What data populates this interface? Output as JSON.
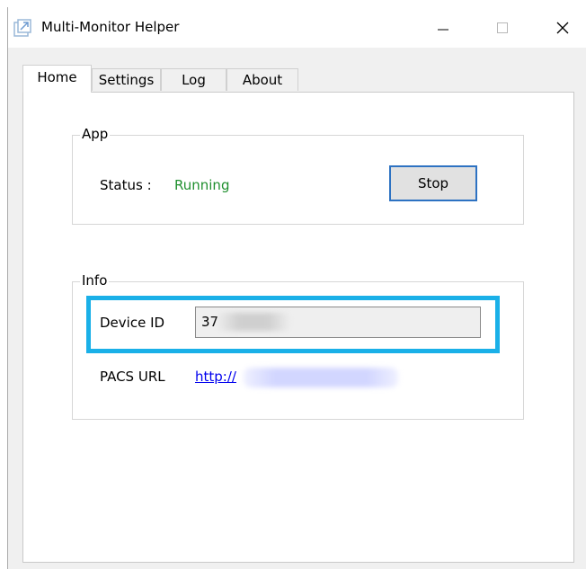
{
  "window": {
    "title": "Multi-Monitor Helper",
    "minimize_glyph": "—",
    "maximize_glyph": "☐",
    "close_glyph": "✕"
  },
  "tabs": [
    {
      "label": "Home",
      "active": true
    },
    {
      "label": "Settings",
      "active": false
    },
    {
      "label": "Log",
      "active": false
    },
    {
      "label": "About",
      "active": false
    }
  ],
  "app_group": {
    "legend": "App",
    "status_label": "Status :",
    "status_value": "Running",
    "stop_label": "Stop"
  },
  "info_group": {
    "legend": "Info",
    "device_id_label": "Device ID",
    "device_id_value": "37",
    "pacs_url_label": "PACS URL",
    "pacs_url_value": "http://"
  },
  "colors": {
    "status_running": "#1f8f2e",
    "highlight": "#1ab0e8",
    "button_focus_border": "#2d72c2",
    "link": "#0000ee"
  },
  "icons": {
    "app": "external-link-icon",
    "minimize": "minimize-icon",
    "maximize": "maximize-icon",
    "close": "close-icon"
  }
}
